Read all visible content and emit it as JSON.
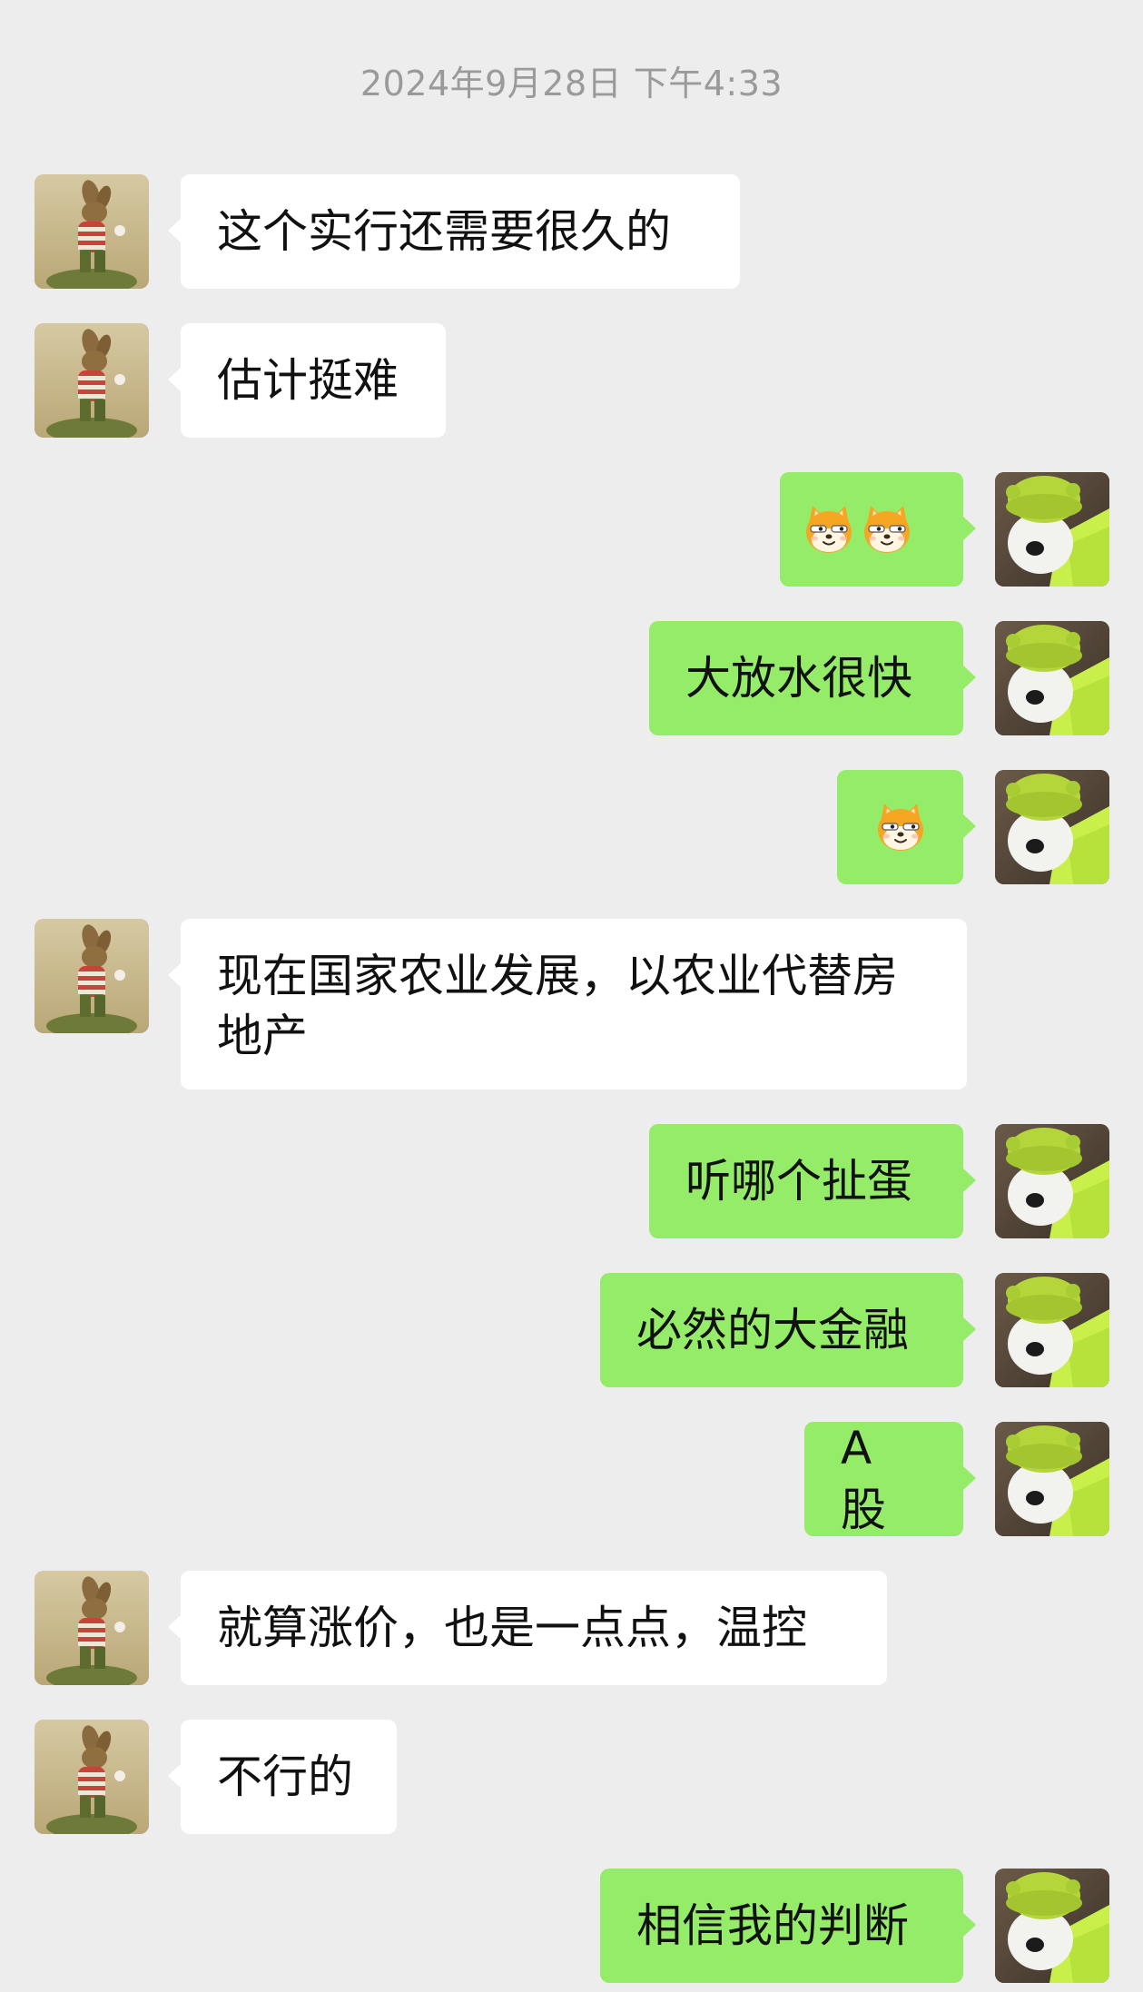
{
  "timestamp": "2024年9月28日 下午4:33",
  "contacts": {
    "incoming_avatar": "rabbit-avatar",
    "outgoing_avatar": "green-hat-dog-avatar"
  },
  "colors": {
    "background": "#ededed",
    "incoming_bubble": "#ffffff",
    "outgoing_bubble": "#95ec69",
    "timestamp_text": "#9a9a9a"
  },
  "messages": [
    {
      "side": "in",
      "text": "这个实行还需要很久的"
    },
    {
      "side": "in",
      "text": "估计挺难"
    },
    {
      "side": "out",
      "emoji": [
        "doge-cat-emoji",
        "doge-cat-emoji"
      ]
    },
    {
      "side": "out",
      "text": "大放水很快"
    },
    {
      "side": "out",
      "emoji": [
        "doge-cat-emoji"
      ]
    },
    {
      "side": "in",
      "text": "现在国家农业发展，以农业代替房地产"
    },
    {
      "side": "out",
      "text": "听哪个扯蛋"
    },
    {
      "side": "out",
      "text": "必然的大金融"
    },
    {
      "side": "out",
      "text": "A 股"
    },
    {
      "side": "in",
      "text": "就算涨价，也是一点点，温控"
    },
    {
      "side": "in",
      "text": "不行的"
    },
    {
      "side": "out",
      "text": "相信我的判断"
    }
  ]
}
